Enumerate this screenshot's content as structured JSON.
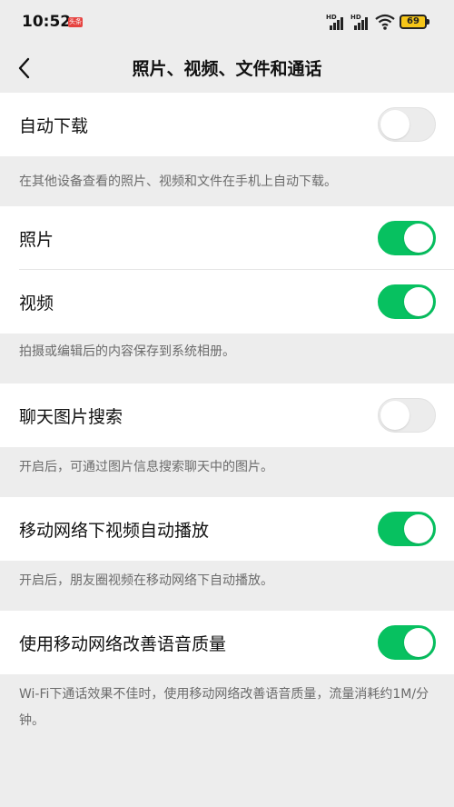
{
  "status_bar": {
    "time": "10:52",
    "notification_badge": "头条",
    "signal1_label": "HD",
    "signal2_label": "HD",
    "battery": "69"
  },
  "nav": {
    "title": "照片、视频、文件和通话"
  },
  "settings": [
    {
      "label": "自动下载",
      "on": false
    },
    {
      "label": "照片",
      "on": true
    },
    {
      "label": "视频",
      "on": true
    },
    {
      "label": "聊天图片搜索",
      "on": false
    },
    {
      "label": "移动网络下视频自动播放",
      "on": true
    },
    {
      "label": "使用移动网络改善语音质量",
      "on": true
    }
  ],
  "notes": {
    "auto_download": "在其他设备查看的照片、视频和文件在手机上自动下载。",
    "photo_video": "拍摄或编辑后的内容保存到系统相册。",
    "image_search": "开启后，可通过图片信息搜索聊天中的图片。",
    "autoplay": "开启后，朋友圈视频在移动网络下自动播放。",
    "voice_quality": "Wi-Fi下通话效果不佳时，使用移动网络改善语音质量，流量消耗约1M/分钟。"
  },
  "colors": {
    "accent_green": "#07c160",
    "toggle_off": "#ececec",
    "background": "#ededed"
  }
}
